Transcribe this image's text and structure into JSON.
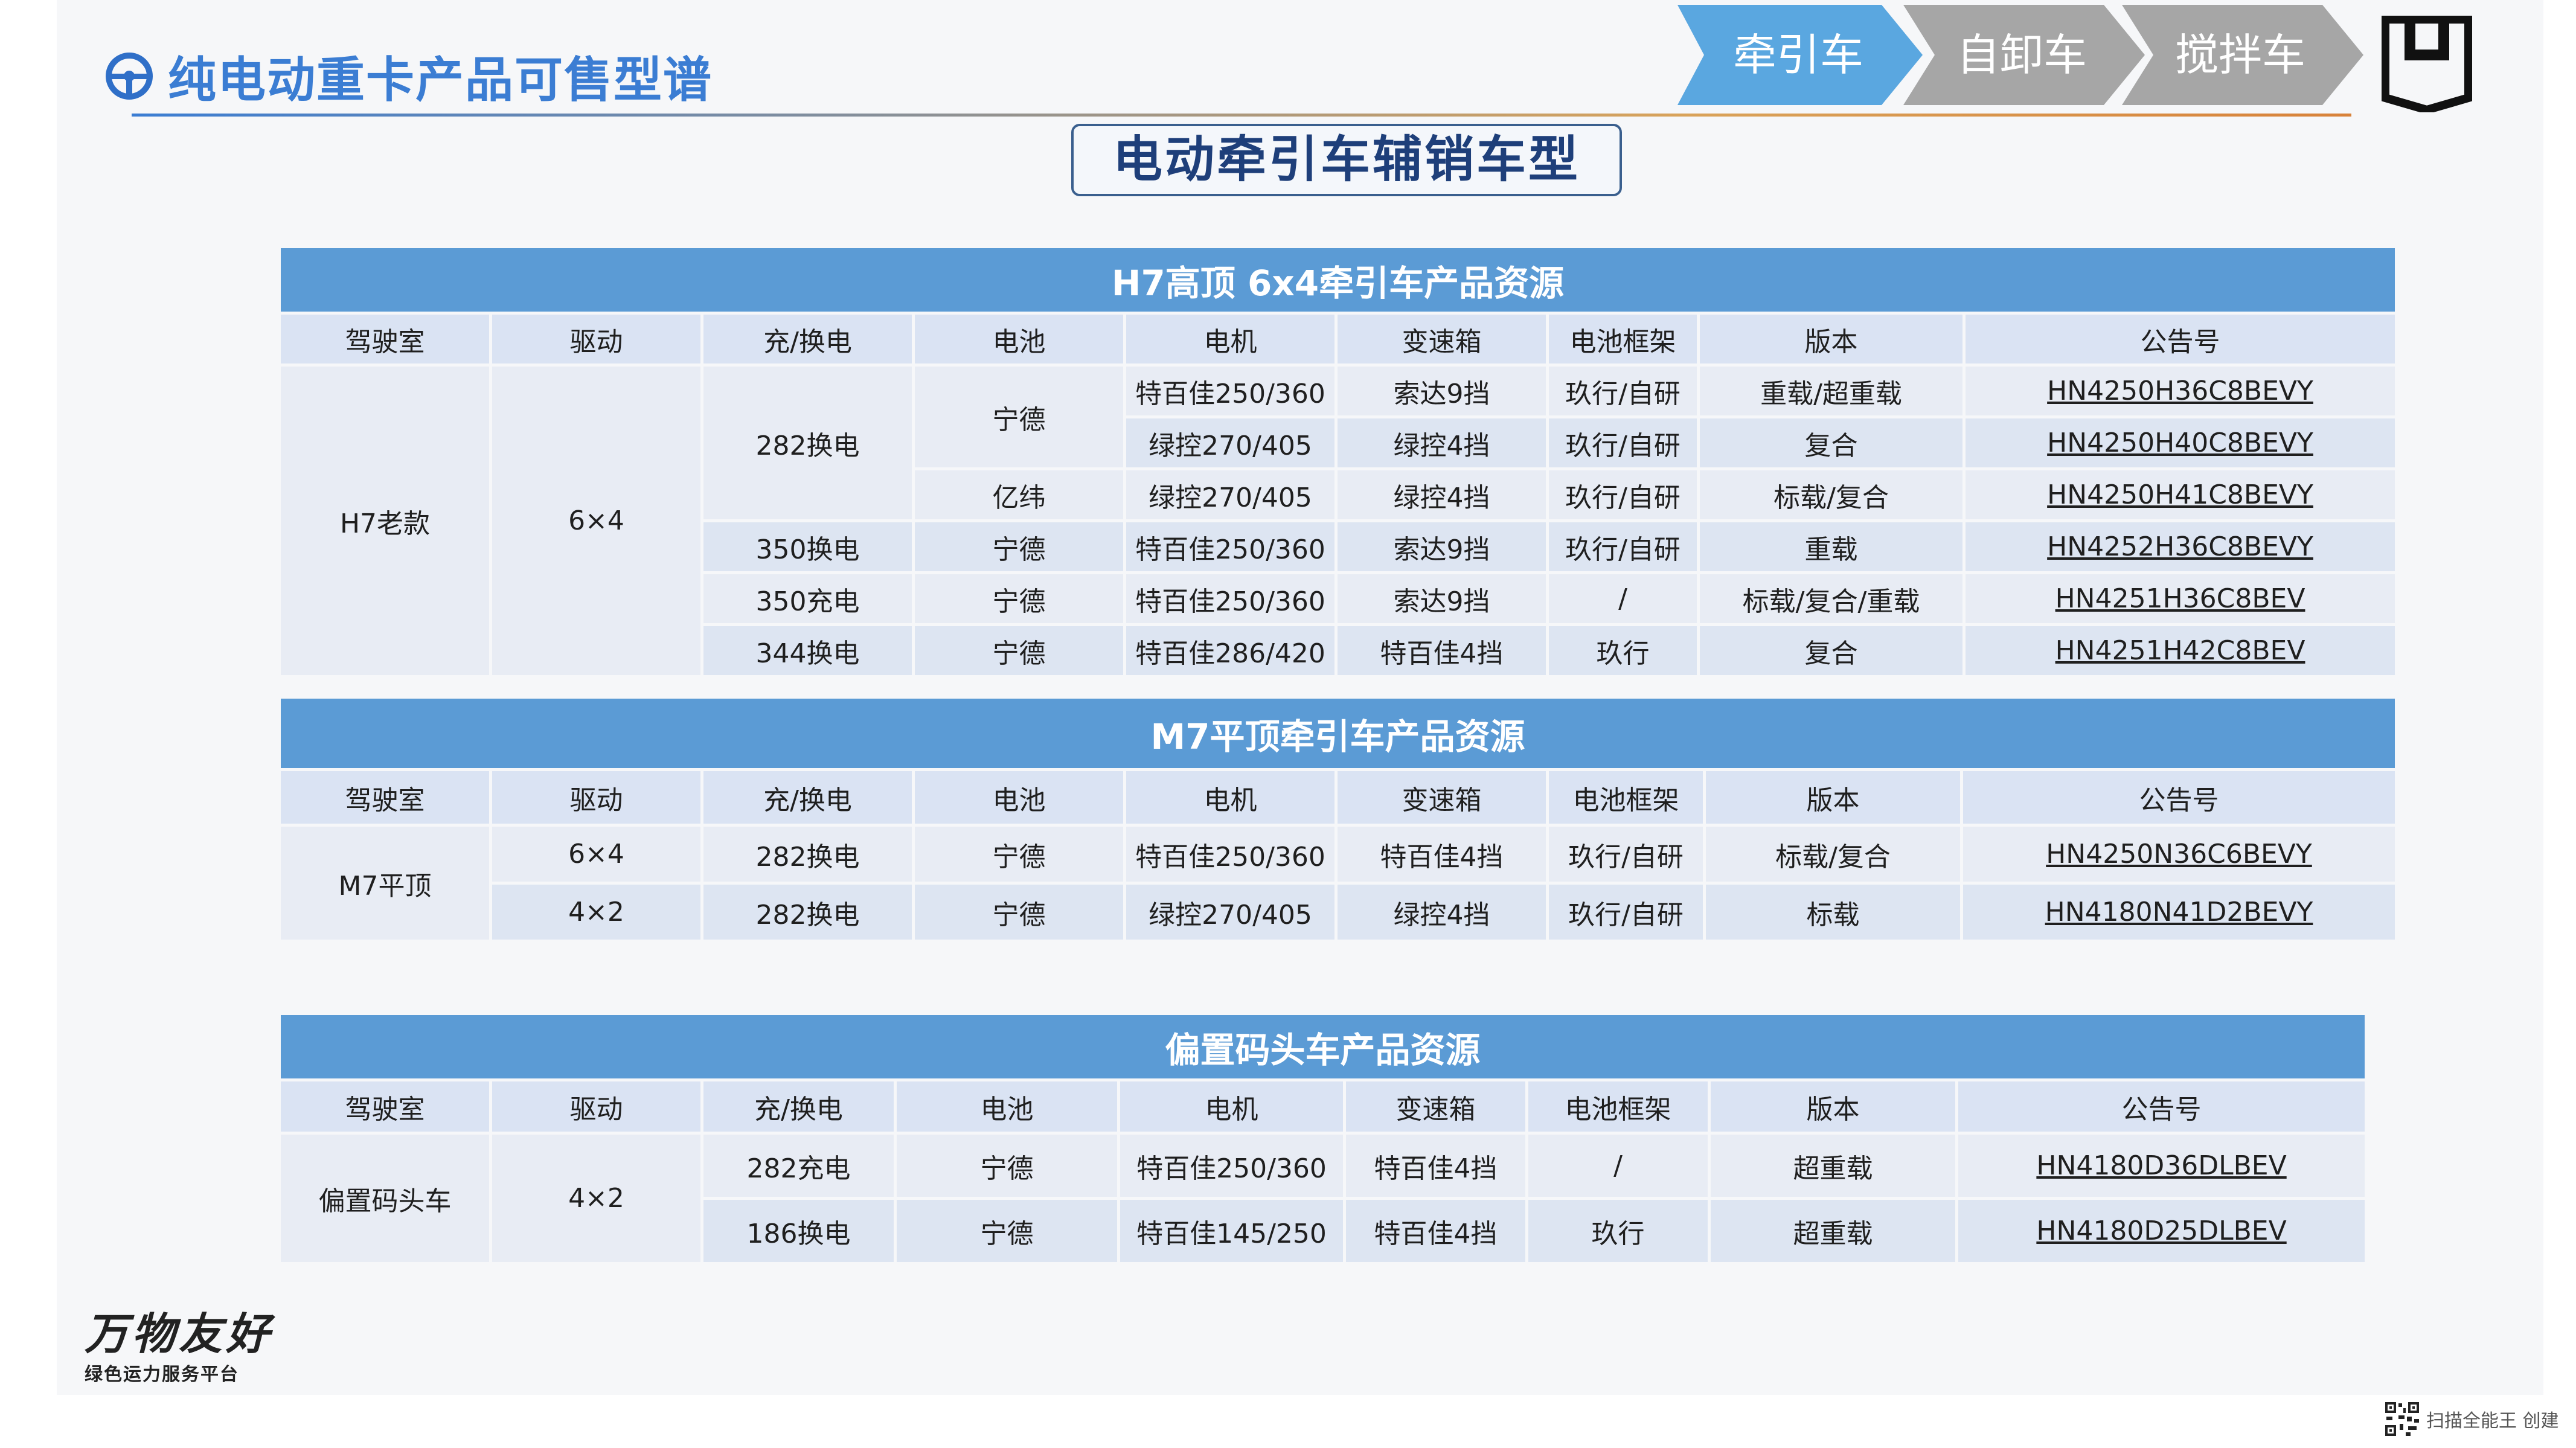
{
  "header": {
    "title": "纯电动重卡产品可售型谱",
    "tabs": [
      {
        "label": "牵引车",
        "active": true
      },
      {
        "label": "自卸车",
        "active": false
      },
      {
        "label": "搅拌车",
        "active": false
      }
    ],
    "subtitle": "电动牵引车辅销车型"
  },
  "colors": {
    "accent": "#3b7dd3",
    "tab_active": "#5aa7e0",
    "tab_inactive": "#a6a6a6",
    "table_title_bg": "#5b9bd5",
    "table_header_bg": "#dae3f3"
  },
  "columns": [
    "驾驶室",
    "驱动",
    "充/换电",
    "电池",
    "电机",
    "变速箱",
    "电池框架",
    "版本",
    "公告号"
  ],
  "table_h7": {
    "title": "H7高顶 6x4牵引车产品资源",
    "cab": "H7老款",
    "drive": "6×4",
    "groups": [
      {
        "charge": "282换电",
        "battery": "宁德"
      },
      {
        "battery": "亿纬"
      }
    ],
    "rows": [
      {
        "charge": "282换电",
        "battery": "宁德",
        "motor": "特百佳250/360",
        "gearbox": "索达9挡",
        "frame": "玖行/自研",
        "version": "重载/超重载",
        "notice": "HN4250H36C8BEVY"
      },
      {
        "charge": "282换电",
        "battery": "宁德",
        "motor": "绿控270/405",
        "gearbox": "绿控4挡",
        "frame": "玖行/自研",
        "version": "复合",
        "notice": "HN4250H40C8BEVY"
      },
      {
        "charge": "282换电",
        "battery": "亿纬",
        "motor": "绿控270/405",
        "gearbox": "绿控4挡",
        "frame": "玖行/自研",
        "version": "标载/复合",
        "notice": "HN4250H41C8BEVY"
      },
      {
        "charge": "350换电",
        "battery": "宁德",
        "motor": "特百佳250/360",
        "gearbox": "索达9挡",
        "frame": "玖行/自研",
        "version": "重载",
        "notice": "HN4252H36C8BEVY"
      },
      {
        "charge": "350充电",
        "battery": "宁德",
        "motor": "特百佳250/360",
        "gearbox": "索达9挡",
        "frame": "/",
        "version": "标载/复合/重载",
        "notice": "HN4251H36C8BEV"
      },
      {
        "charge": "344换电",
        "battery": "宁德",
        "motor": "特百佳286/420",
        "gearbox": "特百佳4挡",
        "frame": "玖行",
        "version": "复合",
        "notice": "HN4251H42C8BEV"
      }
    ]
  },
  "table_m7": {
    "title": "M7平顶牵引车产品资源",
    "cab": "M7平顶",
    "rows": [
      {
        "drive": "6×4",
        "charge": "282换电",
        "battery": "宁德",
        "motor": "特百佳250/360",
        "gearbox": "特百佳4挡",
        "frame": "玖行/自研",
        "version": "标载/复合",
        "notice": "HN4250N36C6BEVY"
      },
      {
        "drive": "4×2",
        "charge": "282换电",
        "battery": "宁德",
        "motor": "绿控270/405",
        "gearbox": "绿控4挡",
        "frame": "玖行/自研",
        "version": "标载",
        "notice": "HN4180N41D2BEVY"
      }
    ]
  },
  "table_dock": {
    "title": "偏置码头车产品资源",
    "cab": "偏置码头车",
    "drive": "4×2",
    "rows": [
      {
        "charge": "282充电",
        "battery": "宁德",
        "motor": "特百佳250/360",
        "gearbox": "特百佳4挡",
        "frame": "/",
        "version": "超重载",
        "notice": "HN4180D36DLBEV"
      },
      {
        "charge": "186换电",
        "battery": "宁德",
        "motor": "特百佳145/250",
        "gearbox": "特百佳4挡",
        "frame": "玖行",
        "version": "超重载",
        "notice": "HN4180D25DLBEV"
      }
    ]
  },
  "footer": {
    "brand": "万物友好",
    "tagline": "绿色运力服务平台",
    "watermark": "扫描全能王 创建",
    "icons": [
      "steering-wheel-icon",
      "shield-logo-icon",
      "qr-code-icon"
    ]
  }
}
